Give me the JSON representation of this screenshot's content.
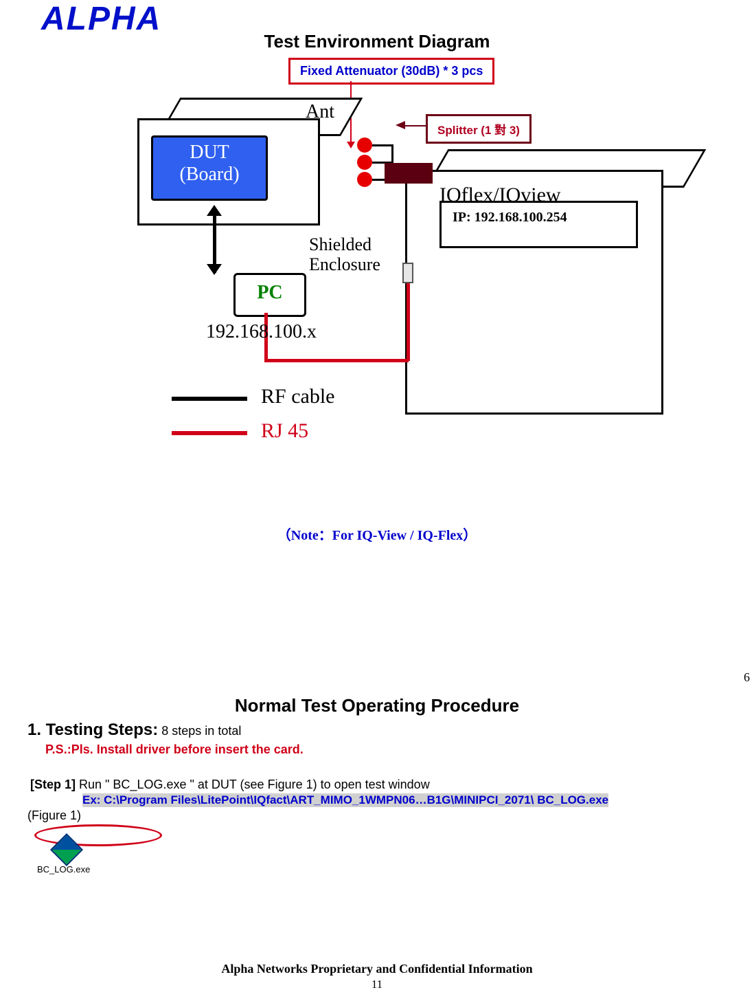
{
  "logo_text": "ALPHA",
  "title": "Test Environment Diagram",
  "diagram": {
    "attenuator_label": "Fixed Attenuator (30dB)  * 3 pcs",
    "splitter_label": "Splitter (1 對 3)",
    "ip_label": "IP: 192.168.100.254",
    "dut_line1": "DUT",
    "dut_line2": "(Board)",
    "ant_label": "Ant",
    "iq_label": "IQflex/IQview",
    "pc_label": "PC",
    "shielded_line1": "Shielded",
    "shielded_line2": "Enclosure",
    "ip_x": "192.168.100.x",
    "legend_rf": "RF cable",
    "legend_rj": "RJ 45"
  },
  "note": "（Note：For IQ-View / IQ-Flex）",
  "side_number": "6",
  "procedure_title": "Normal Test Operating Procedure",
  "testing_steps_label": "1. Testing Steps:",
  "testing_steps_suffix": " 8 steps in total",
  "ps_line": "P.S.:Pls. Install driver before insert the card.",
  "step1_label": "[Step 1]",
  "step1_text": " Run \" BC_LOG.exe \" at DUT (see Figure 1) to open test window",
  "step1_ex": "Ex: C:\\Program Files\\LitePoint\\IQfact\\ART_MIMO_1WMPN06…B1G\\MINIPCI_2071\\ BC_LOG.exe",
  "figure1": "(Figure 1)",
  "bc_icon_label": "BC_LOG.exe",
  "footer_line": "Alpha Networks Proprietary and Confidential Information",
  "page_number": "11"
}
